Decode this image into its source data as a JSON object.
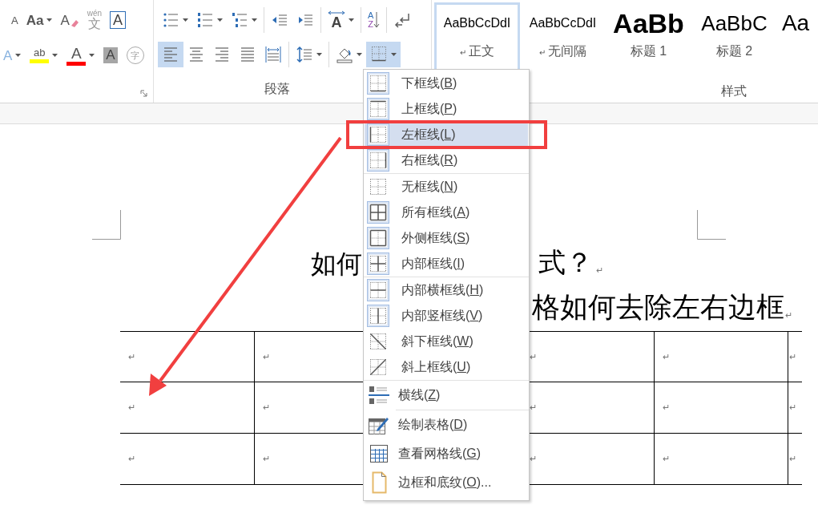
{
  "ribbon": {
    "font_group": {
      "row1": [
        {
          "kind": "shrink",
          "glyph": "A",
          "dropdown": false
        },
        {
          "kind": "case",
          "glyph": "Aa",
          "dropdown": true
        },
        {
          "kind": "clear",
          "glyph": "A",
          "dropdown": false
        },
        {
          "kind": "phonetic",
          "glyph": "wén",
          "glyph2": "文",
          "dropdown": false
        },
        {
          "kind": "boxed",
          "glyph": "A",
          "dropdown": false
        }
      ],
      "row2": [
        {
          "kind": "effects",
          "glyph": "A",
          "dropdown": true
        },
        {
          "kind": "highlight",
          "glyph": "ab",
          "dropdown": true
        },
        {
          "kind": "fontcolor",
          "glyph": "A",
          "dropdown": true
        },
        {
          "kind": "shade",
          "glyph": "A",
          "dropdown": false
        },
        {
          "kind": "enclose",
          "glyph": "字",
          "dropdown": false
        }
      ]
    },
    "paragraph_group": {
      "label": "段落",
      "row1": [
        [
          {
            "kind": "bullets",
            "dropdown": true,
            "selected": false
          },
          {
            "kind": "numbering",
            "dropdown": true,
            "selected": false
          },
          {
            "kind": "multilevel",
            "dropdown": true,
            "selected": false
          }
        ],
        [
          {
            "kind": "outdent",
            "dropdown": false,
            "selected": false
          },
          {
            "kind": "indent",
            "dropdown": false,
            "selected": false
          }
        ],
        [
          {
            "kind": "layout",
            "glyph": "A",
            "dropdown": true,
            "selected": false
          }
        ],
        [
          {
            "kind": "sort",
            "glyph": "A",
            "glyph2": "Z",
            "dropdown": false,
            "selected": false
          }
        ],
        [
          {
            "kind": "marks",
            "dropdown": false,
            "selected": false
          }
        ]
      ],
      "row2": [
        [
          {
            "kind": "alignleft",
            "dropdown": false,
            "selected": true
          },
          {
            "kind": "center",
            "dropdown": false,
            "selected": false
          },
          {
            "kind": "alignright",
            "dropdown": false,
            "selected": false
          },
          {
            "kind": "justify",
            "dropdown": false,
            "selected": false
          },
          {
            "kind": "distribute",
            "dropdown": false,
            "selected": false
          }
        ],
        [
          {
            "kind": "spacing",
            "dropdown": true,
            "selected": false
          }
        ],
        [
          {
            "kind": "shading",
            "dropdown": true,
            "selected": false
          },
          {
            "kind": "borders",
            "dropdown": true,
            "selected": true
          }
        ]
      ]
    },
    "styles_group": {
      "label": "样式",
      "items": [
        {
          "kind": "normal",
          "sample": "AaBbCcDdI",
          "mark": "↵",
          "name": "正文",
          "selected": true
        },
        {
          "kind": "normal",
          "sample": "AaBbCcDdI",
          "mark": "↵",
          "name": "无间隔",
          "selected": false
        },
        {
          "kind": "heading1",
          "sample": "AaBb",
          "name": "标题 1",
          "selected": false
        },
        {
          "kind": "heading2",
          "sample": "AaBbC",
          "name": "标题 2",
          "selected": false
        },
        {
          "kind": "heading3",
          "sample": "Aa",
          "selected": false
        }
      ]
    }
  },
  "document": {
    "title": {
      "left": "如何",
      "right": "式？",
      "mark": "↵"
    },
    "subtitle": {
      "text": "格如何去除左右边框",
      "mark": "↵"
    },
    "table": {
      "rows": [
        {
          "cells": [
            "↵",
            "↵",
            null,
            "↵",
            "↵"
          ],
          "end_mark": "↵"
        },
        {
          "cells": [
            "↵",
            "↵",
            null,
            "↵",
            "↵"
          ],
          "end_mark": "↵"
        },
        {
          "cells": [
            "↵",
            "↵",
            null,
            "↵",
            "↵"
          ],
          "end_mark": "↵"
        }
      ]
    }
  },
  "borders_menu": {
    "sections": [
      [
        {
          "kind": "bottom",
          "label": "下框线(",
          "key": "B",
          "tail": ")",
          "selected": false
        },
        {
          "kind": "top",
          "label": "上框线(",
          "key": "P",
          "tail": ")",
          "selected": false
        },
        {
          "kind": "left",
          "label": "左框线(",
          "key": "L",
          "tail": ")",
          "selected": true
        },
        {
          "kind": "right",
          "label": "右框线(",
          "key": "R",
          "tail": ")",
          "selected": false
        }
      ],
      [
        {
          "kind": "none",
          "label": "无框线(",
          "key": "N",
          "tail": ")",
          "selected": false
        },
        {
          "kind": "all",
          "label": "所有框线(",
          "key": "A",
          "tail": ")",
          "selected": false
        },
        {
          "kind": "outside",
          "label": "外侧框线(",
          "key": "S",
          "tail": ")",
          "selected": false
        },
        {
          "kind": "inside",
          "label": "内部框线(",
          "key": "I",
          "tail": ")",
          "selected": false
        }
      ],
      [
        {
          "kind": "insideh",
          "label": "内部横框线(",
          "key": "H",
          "tail": ")",
          "selected": false
        },
        {
          "kind": "insidev",
          "label": "内部竖框线(",
          "key": "V",
          "tail": ")",
          "selected": false
        },
        {
          "kind": "diagdown",
          "label": "斜下框线(",
          "key": "W",
          "tail": ")",
          "selected": false
        },
        {
          "kind": "diagup",
          "label": "斜上框线(",
          "key": "U",
          "tail": ")",
          "selected": false
        }
      ],
      [
        {
          "kind": "hline",
          "label": "横线(",
          "key": "Z",
          "tail": ")",
          "selected": false
        }
      ],
      [
        {
          "kind": "draw",
          "label": "绘制表格(",
          "key": "D",
          "tail": ")",
          "selected": false
        },
        {
          "kind": "grid",
          "label": "查看网格线(",
          "key": "G",
          "tail": ")",
          "selected": false
        },
        {
          "kind": "dialog",
          "label": "边框和底纹(",
          "key": "O",
          "tail": ")...",
          "selected": false
        }
      ]
    ]
  }
}
